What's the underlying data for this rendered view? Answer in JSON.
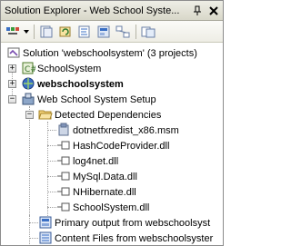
{
  "window": {
    "title": "Solution Explorer - Web School Syste...",
    "pin_icon": "pin-icon",
    "close_icon": "close-icon"
  },
  "toolbar": {
    "icons": [
      "properties-icon",
      "show-all-files-icon",
      "refresh-icon",
      "view-code-icon",
      "view-designer-icon",
      "class-diagram-icon",
      "copy-website-icon"
    ]
  },
  "tree": {
    "solution": "Solution 'webschoolsystem' (3 projects)",
    "projects": [
      {
        "label": "SchoolSystem",
        "bold": false
      },
      {
        "label": "webschoolsystem",
        "bold": true
      },
      {
        "label": "Web School System Setup",
        "bold": false
      }
    ],
    "detected_dependencies": "Detected Dependencies",
    "dependencies": [
      "dotnetfxredist_x86.msm",
      "HashCodeProvider.dll",
      "log4net.dll",
      "MySql.Data.dll",
      "NHibernate.dll",
      "SchoolSystem.dll"
    ],
    "outputs": [
      "Primary output from webschoolsyst",
      "Content Files from webschoolsyster"
    ]
  },
  "colors": {
    "titlebar": "#d8d7c9",
    "folder": "#f3d27a",
    "project_blue": "#3a6fc4"
  }
}
